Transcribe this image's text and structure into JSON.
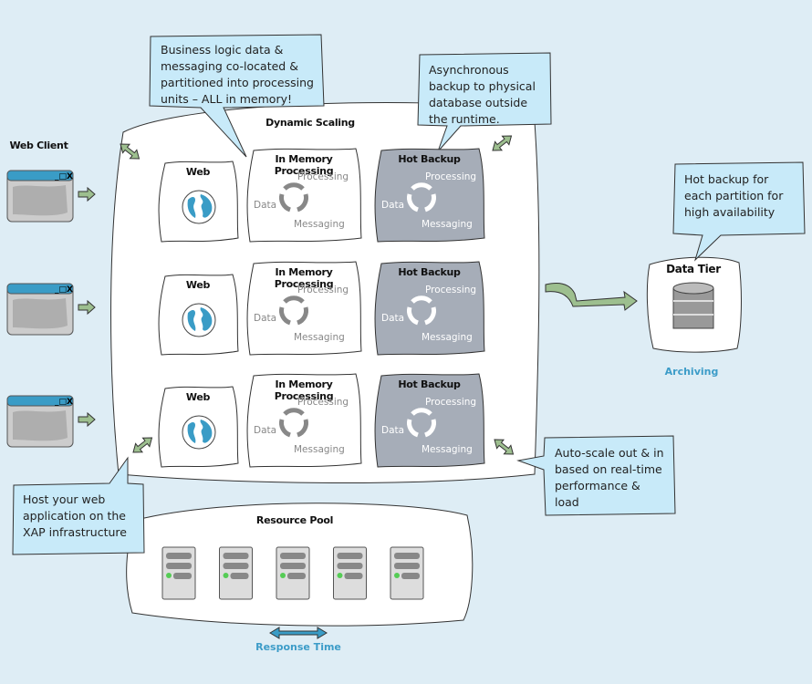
{
  "colors": {
    "background": "#deedf5",
    "callout": "#c8eaf9",
    "accent_blue": "#3a9cc6",
    "arrow_green": "#9dbf8f",
    "hot_backup": "#a6adb8"
  },
  "web_client": {
    "title": "Web Client",
    "count": 3
  },
  "dynamic_scaling": {
    "title": "Dynamic Scaling"
  },
  "rows": [
    {
      "web": "Web",
      "imp": {
        "title": "In Memory Processing",
        "processing": "Processing",
        "data": "Data",
        "messaging": "Messaging"
      },
      "hot": {
        "title": "Hot Backup",
        "processing": "Processing",
        "data": "Data",
        "messaging": "Messaging"
      }
    },
    {
      "web": "Web",
      "imp": {
        "title": "In Memory Processing",
        "processing": "Processing",
        "data": "Data",
        "messaging": "Messaging"
      },
      "hot": {
        "title": "Hot Backup",
        "processing": "Processing",
        "data": "Data",
        "messaging": "Messaging"
      }
    },
    {
      "web": "Web",
      "imp": {
        "title": "In Memory Processing",
        "processing": "Processing",
        "data": "Data",
        "messaging": "Messaging"
      },
      "hot": {
        "title": "Hot Backup",
        "processing": "Processing",
        "data": "Data",
        "messaging": "Messaging"
      }
    }
  ],
  "callouts": {
    "business_logic": "Business logic data & messaging co-located & partitioned into processing units – ALL in memory!",
    "async_backup": "Asynchronous backup to physical database outside the runtime.",
    "hot_backup": "Hot backup for each partition for high availability",
    "auto_scale": "Auto-scale out & in based on real-time performance & load",
    "host_web": "Host your web application on the XAP infrastructure"
  },
  "data_tier": {
    "title": "Data Tier",
    "archiving": "Archiving"
  },
  "resource_pool": {
    "title": "Resource Pool",
    "servers": 5,
    "response_time": "Response Time"
  }
}
